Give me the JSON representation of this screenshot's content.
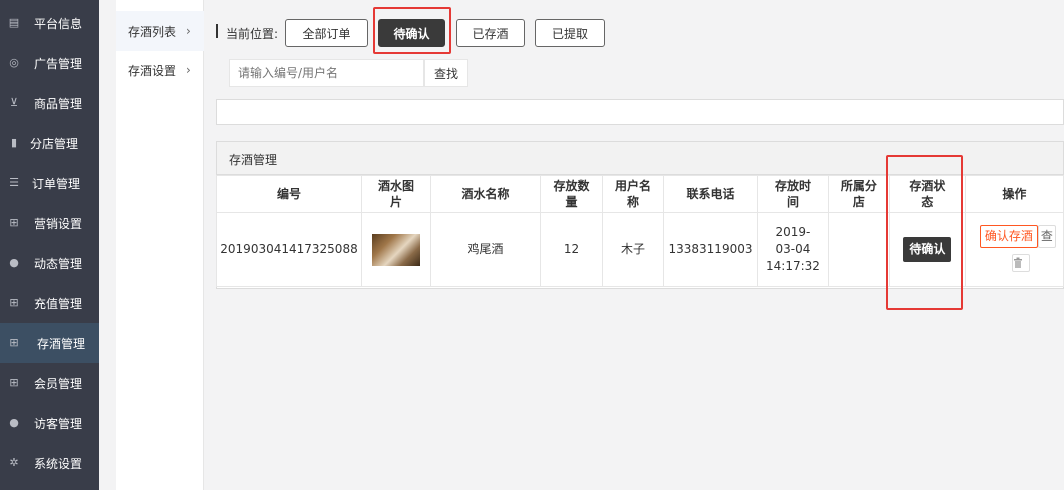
{
  "sidebar": {
    "items": [
      {
        "label": "平台信息",
        "icon": "newspaper-icon",
        "glyph": "▤"
      },
      {
        "label": "广告管理",
        "icon": "lifebuoy-icon",
        "glyph": "◎"
      },
      {
        "label": "商品管理",
        "icon": "cart-icon",
        "glyph": "⊻"
      },
      {
        "label": "分店管理",
        "icon": "book-icon",
        "glyph": "▮"
      },
      {
        "label": "订单管理",
        "icon": "list-icon",
        "glyph": "☰"
      },
      {
        "label": "营销设置",
        "icon": "gift-icon",
        "glyph": "⊞"
      },
      {
        "label": "动态管理",
        "icon": "user-icon",
        "glyph": "●"
      },
      {
        "label": "充值管理",
        "icon": "gift-icon",
        "glyph": "⊞"
      },
      {
        "label": "存酒管理",
        "icon": "gift-icon",
        "glyph": "⊞"
      },
      {
        "label": "会员管理",
        "icon": "gift-icon",
        "glyph": "⊞"
      },
      {
        "label": "访客管理",
        "icon": "user-icon",
        "glyph": "●"
      },
      {
        "label": "系统设置",
        "icon": "gear-icon",
        "glyph": "✲"
      }
    ]
  },
  "subnav": {
    "items": [
      {
        "label": "存酒列表",
        "chevron": "›"
      },
      {
        "label": "存酒设置",
        "chevron": "›"
      }
    ]
  },
  "breadcrumb": {
    "label": "当前位置:"
  },
  "filters": {
    "all": "全部订单",
    "pending": "待确认",
    "stored": "已存酒",
    "taken": "已提取"
  },
  "search": {
    "placeholder": "请输入编号/用户名",
    "button": "查找"
  },
  "panel": {
    "title": "存酒管理"
  },
  "table": {
    "headers": {
      "id": "编号",
      "image": "酒水图片",
      "name": "酒水名称",
      "qty": "存放数量",
      "user": "用户名称",
      "phone": "联系电话",
      "time": "存放时间",
      "branch": "所属分店",
      "status": "存酒状态",
      "ops": "操作"
    },
    "rows": [
      {
        "id": "201903041417325088",
        "name": "鸡尾酒",
        "qty": "12",
        "user": "木子",
        "phone": "13383119003",
        "time": "2019-03-04 14:17:32",
        "branch": "",
        "status": "待确认",
        "confirm": "确认存酒",
        "view": "查"
      }
    ]
  },
  "colors": {
    "sidebar_bg": "#393d49",
    "sidebar_active": "#3c4f63",
    "highlight_red": "#e53935",
    "confirm_orange": "#ff5722",
    "dark_button": "#3a3a3a"
  }
}
